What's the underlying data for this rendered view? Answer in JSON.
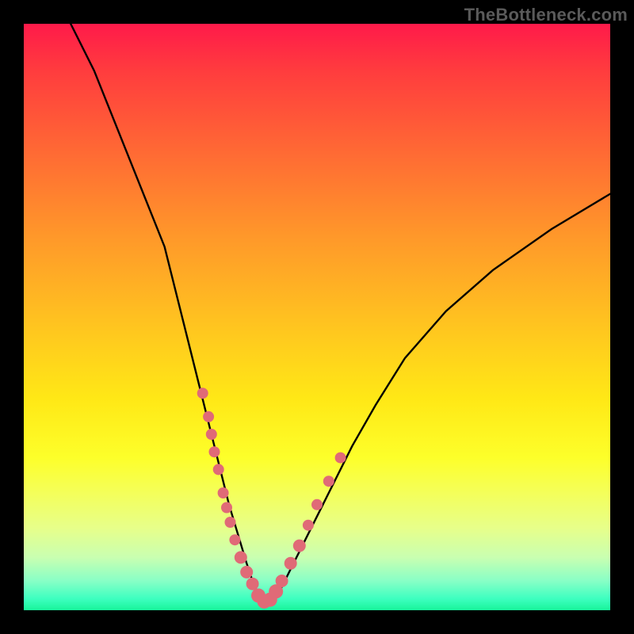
{
  "watermark": "TheBottleneck.com",
  "colors": {
    "frame": "#000000",
    "gradient_top": "#ff1a4a",
    "gradient_bottom": "#18f59a",
    "curve": "#000000",
    "dots": "#e06a77"
  },
  "chart_data": {
    "type": "line",
    "title": "",
    "xlabel": "",
    "ylabel": "",
    "xlim": [
      0,
      100
    ],
    "ylim": [
      0,
      100
    ],
    "grid": false,
    "legend": false,
    "series": [
      {
        "name": "bottleneck-curve",
        "x": [
          8,
          12,
          16,
          20,
          24,
          28,
          30,
          32,
          33.5,
          35,
          36.5,
          38,
          39,
          40,
          41,
          42,
          43.5,
          45,
          48,
          52,
          56,
          60,
          65,
          72,
          80,
          90,
          100
        ],
        "y": [
          100,
          92,
          82,
          72,
          62,
          46,
          38,
          30,
          24,
          18,
          13,
          8,
          5,
          2.5,
          1.2,
          1.5,
          3,
          6,
          12,
          20,
          28,
          35,
          43,
          51,
          58,
          65,
          71
        ]
      }
    ],
    "overlay_points": {
      "name": "highlighted-dots",
      "x": [
        30.5,
        31.5,
        32,
        32.5,
        33.2,
        34,
        34.6,
        35.2,
        36,
        37,
        38,
        39,
        40,
        41,
        42,
        43,
        44,
        45.5,
        47,
        48.5,
        50,
        52,
        54
      ],
      "y": [
        37,
        33,
        30,
        27,
        24,
        20,
        17.5,
        15,
        12,
        9,
        6.5,
        4.5,
        2.5,
        1.5,
        1.8,
        3.2,
        5,
        8,
        11,
        14.5,
        18,
        22,
        26
      ]
    }
  }
}
